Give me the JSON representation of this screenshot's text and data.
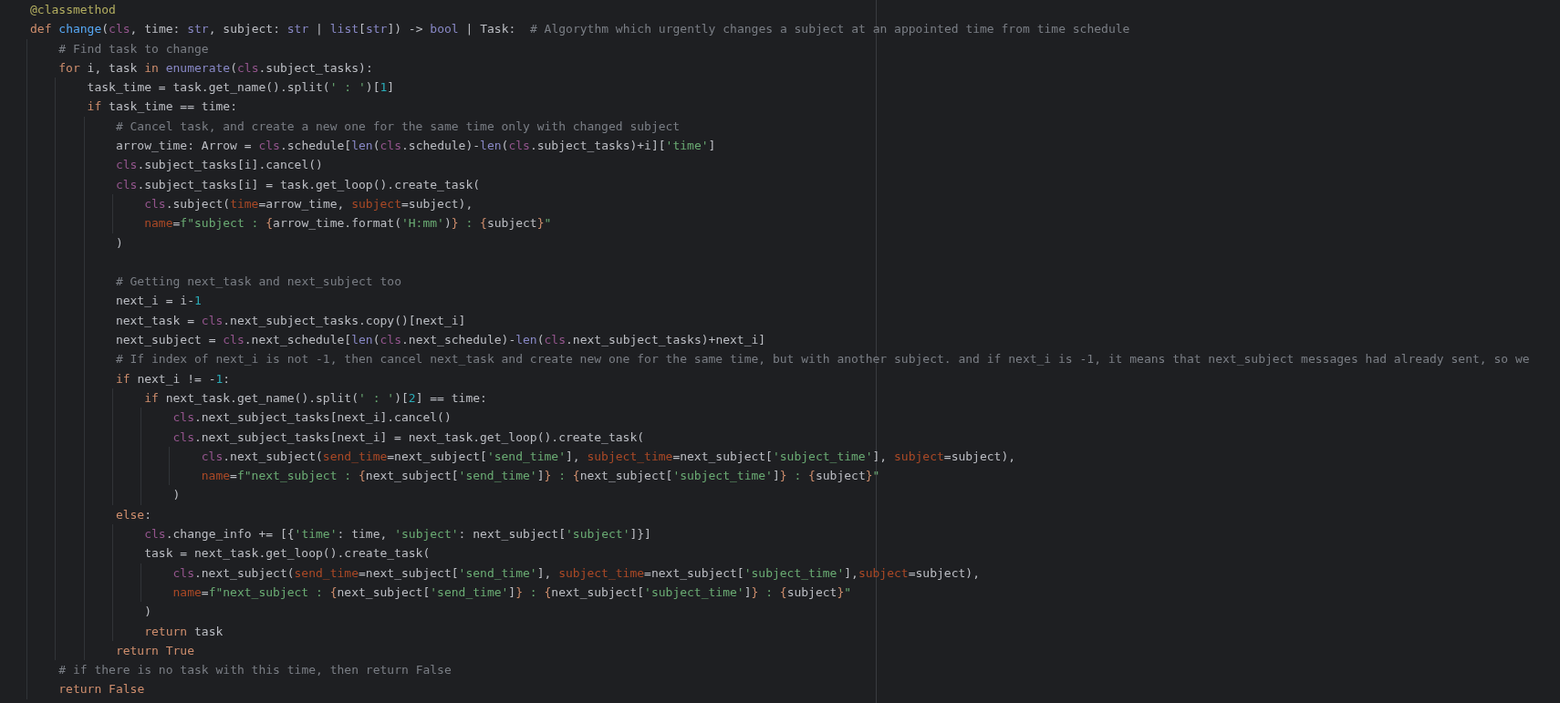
{
  "editor": {
    "lines": [
      {
        "kind": "code",
        "tokens": [
          {
            "kind": "decorator",
            "text": "@classmethod"
          }
        ]
      },
      {
        "kind": "code",
        "tokens": [
          {
            "kind": "keyword",
            "text": "def "
          },
          {
            "kind": "function",
            "text": "change"
          },
          {
            "kind": "plain",
            "text": "("
          },
          {
            "kind": "self",
            "text": "cls"
          },
          {
            "kind": "plain",
            "text": ", time: "
          },
          {
            "kind": "builtin",
            "text": "str"
          },
          {
            "kind": "plain",
            "text": ", subject: "
          },
          {
            "kind": "builtin",
            "text": "str"
          },
          {
            "kind": "plain",
            "text": " | "
          },
          {
            "kind": "builtin",
            "text": "list"
          },
          {
            "kind": "plain",
            "text": "["
          },
          {
            "kind": "builtin",
            "text": "str"
          },
          {
            "kind": "plain",
            "text": "]) -> "
          },
          {
            "kind": "builtin",
            "text": "bool"
          },
          {
            "kind": "plain",
            "text": " | Task:  "
          },
          {
            "kind": "comment",
            "text": "# Algorythm which urgently changes a subject at an appointed time from time schedule"
          }
        ],
        "children": [
          {
            "kind": "code",
            "tokens": [
              {
                "kind": "comment",
                "text": "# Find task to change"
              }
            ]
          },
          {
            "kind": "code",
            "tokens": [
              {
                "kind": "keyword",
                "text": "for "
              },
              {
                "kind": "plain",
                "text": "i, task "
              },
              {
                "kind": "keyword",
                "text": "in "
              },
              {
                "kind": "builtin",
                "text": "enumerate"
              },
              {
                "kind": "plain",
                "text": "("
              },
              {
                "kind": "self",
                "text": "cls"
              },
              {
                "kind": "plain",
                "text": ".subject_tasks):"
              }
            ],
            "children": [
              {
                "kind": "code",
                "tokens": [
                  {
                    "kind": "plain",
                    "text": "task_time = task.get_name().split("
                  },
                  {
                    "kind": "string",
                    "text": "' : '"
                  },
                  {
                    "kind": "plain",
                    "text": ")["
                  },
                  {
                    "kind": "number",
                    "text": "1"
                  },
                  {
                    "kind": "plain",
                    "text": "]"
                  }
                ]
              },
              {
                "kind": "code",
                "tokens": [
                  {
                    "kind": "keyword",
                    "text": "if "
                  },
                  {
                    "kind": "plain",
                    "text": "task_time == time:"
                  }
                ],
                "children": [
                  {
                    "kind": "code",
                    "tokens": [
                      {
                        "kind": "comment",
                        "text": "# Cancel task, and create a new one for the same time only with changed subject"
                      }
                    ]
                  },
                  {
                    "kind": "code",
                    "tokens": [
                      {
                        "kind": "plain",
                        "text": "arrow_time: Arrow = "
                      },
                      {
                        "kind": "self",
                        "text": "cls"
                      },
                      {
                        "kind": "plain",
                        "text": ".schedule["
                      },
                      {
                        "kind": "builtin",
                        "text": "len"
                      },
                      {
                        "kind": "plain",
                        "text": "("
                      },
                      {
                        "kind": "self",
                        "text": "cls"
                      },
                      {
                        "kind": "plain",
                        "text": ".schedule)-"
                      },
                      {
                        "kind": "builtin",
                        "text": "len"
                      },
                      {
                        "kind": "plain",
                        "text": "("
                      },
                      {
                        "kind": "self",
                        "text": "cls"
                      },
                      {
                        "kind": "plain",
                        "text": ".subject_tasks)+i]["
                      },
                      {
                        "kind": "string",
                        "text": "'time'"
                      },
                      {
                        "kind": "plain",
                        "text": "]"
                      }
                    ]
                  },
                  {
                    "kind": "code",
                    "tokens": [
                      {
                        "kind": "self",
                        "text": "cls"
                      },
                      {
                        "kind": "plain",
                        "text": ".subject_tasks[i].cancel()"
                      }
                    ]
                  },
                  {
                    "kind": "code",
                    "tokens": [
                      {
                        "kind": "self",
                        "text": "cls"
                      },
                      {
                        "kind": "plain",
                        "text": ".subject_tasks[i] = task.get_loop().create_task("
                      }
                    ],
                    "children": [
                      {
                        "kind": "code",
                        "tokens": [
                          {
                            "kind": "self",
                            "text": "cls"
                          },
                          {
                            "kind": "plain",
                            "text": ".subject("
                          },
                          {
                            "kind": "param",
                            "text": "time"
                          },
                          {
                            "kind": "plain",
                            "text": "=arrow_time, "
                          },
                          {
                            "kind": "param",
                            "text": "subject"
                          },
                          {
                            "kind": "plain",
                            "text": "=subject),"
                          }
                        ]
                      },
                      {
                        "kind": "code",
                        "tokens": [
                          {
                            "kind": "param",
                            "text": "name"
                          },
                          {
                            "kind": "plain",
                            "text": "="
                          },
                          {
                            "kind": "string",
                            "text": "f\"subject : "
                          },
                          {
                            "kind": "fbrace",
                            "text": "{"
                          },
                          {
                            "kind": "plain",
                            "text": "arrow_time.format("
                          },
                          {
                            "kind": "string",
                            "text": "'H:mm'"
                          },
                          {
                            "kind": "plain",
                            "text": ")"
                          },
                          {
                            "kind": "fbrace",
                            "text": "}"
                          },
                          {
                            "kind": "string",
                            "text": " : "
                          },
                          {
                            "kind": "fbrace",
                            "text": "{"
                          },
                          {
                            "kind": "plain",
                            "text": "subject"
                          },
                          {
                            "kind": "fbrace",
                            "text": "}"
                          },
                          {
                            "kind": "string",
                            "text": "\""
                          }
                        ]
                      }
                    ]
                  },
                  {
                    "kind": "code",
                    "tokens": [
                      {
                        "kind": "plain",
                        "text": ")"
                      }
                    ]
                  },
                  {
                    "kind": "blank"
                  },
                  {
                    "kind": "code",
                    "tokens": [
                      {
                        "kind": "comment",
                        "text": "# Getting next_task and next_subject too"
                      }
                    ]
                  },
                  {
                    "kind": "code",
                    "tokens": [
                      {
                        "kind": "plain",
                        "text": "next_i = i-"
                      },
                      {
                        "kind": "number",
                        "text": "1"
                      }
                    ]
                  },
                  {
                    "kind": "code",
                    "tokens": [
                      {
                        "kind": "plain",
                        "text": "next_task = "
                      },
                      {
                        "kind": "self",
                        "text": "cls"
                      },
                      {
                        "kind": "plain",
                        "text": ".next_subject_tasks.copy()[next_i]"
                      }
                    ]
                  },
                  {
                    "kind": "code",
                    "tokens": [
                      {
                        "kind": "plain",
                        "text": "next_subject = "
                      },
                      {
                        "kind": "self",
                        "text": "cls"
                      },
                      {
                        "kind": "plain",
                        "text": ".next_schedule["
                      },
                      {
                        "kind": "builtin",
                        "text": "len"
                      },
                      {
                        "kind": "plain",
                        "text": "("
                      },
                      {
                        "kind": "self",
                        "text": "cls"
                      },
                      {
                        "kind": "plain",
                        "text": ".next_schedule)-"
                      },
                      {
                        "kind": "builtin",
                        "text": "len"
                      },
                      {
                        "kind": "plain",
                        "text": "("
                      },
                      {
                        "kind": "self",
                        "text": "cls"
                      },
                      {
                        "kind": "plain",
                        "text": ".next_subject_tasks)+next_i]"
                      }
                    ]
                  },
                  {
                    "kind": "code",
                    "tokens": [
                      {
                        "kind": "comment",
                        "text": "# If index of next_i is not -1, then cancel next_task and create new one for the same time, but with another subject. and if next_i is -1, it means that next_subject messages had already sent, so we"
                      }
                    ]
                  },
                  {
                    "kind": "code",
                    "tokens": [
                      {
                        "kind": "keyword",
                        "text": "if "
                      },
                      {
                        "kind": "plain",
                        "text": "next_i != -"
                      },
                      {
                        "kind": "number",
                        "text": "1"
                      },
                      {
                        "kind": "plain",
                        "text": ":"
                      }
                    ],
                    "children": [
                      {
                        "kind": "code",
                        "tokens": [
                          {
                            "kind": "keyword",
                            "text": "if "
                          },
                          {
                            "kind": "plain",
                            "text": "next_task.get_name().split("
                          },
                          {
                            "kind": "string",
                            "text": "' : '"
                          },
                          {
                            "kind": "plain",
                            "text": ")["
                          },
                          {
                            "kind": "number",
                            "text": "2"
                          },
                          {
                            "kind": "plain",
                            "text": "] == time:"
                          }
                        ],
                        "children": [
                          {
                            "kind": "code",
                            "tokens": [
                              {
                                "kind": "self",
                                "text": "cls"
                              },
                              {
                                "kind": "plain",
                                "text": ".next_subject_tasks[next_i].cancel()"
                              }
                            ]
                          },
                          {
                            "kind": "code",
                            "tokens": [
                              {
                                "kind": "self",
                                "text": "cls"
                              },
                              {
                                "kind": "plain",
                                "text": ".next_subject_tasks[next_i] = next_task.get_loop().create_task("
                              }
                            ],
                            "children": [
                              {
                                "kind": "code",
                                "tokens": [
                                  {
                                    "kind": "self",
                                    "text": "cls"
                                  },
                                  {
                                    "kind": "plain",
                                    "text": ".next_subject("
                                  },
                                  {
                                    "kind": "param",
                                    "text": "send_time"
                                  },
                                  {
                                    "kind": "plain",
                                    "text": "=next_subject["
                                  },
                                  {
                                    "kind": "string",
                                    "text": "'send_time'"
                                  },
                                  {
                                    "kind": "plain",
                                    "text": "], "
                                  },
                                  {
                                    "kind": "param",
                                    "text": "subject_time"
                                  },
                                  {
                                    "kind": "plain",
                                    "text": "=next_subject["
                                  },
                                  {
                                    "kind": "string",
                                    "text": "'subject_time'"
                                  },
                                  {
                                    "kind": "plain",
                                    "text": "], "
                                  },
                                  {
                                    "kind": "param",
                                    "text": "subject"
                                  },
                                  {
                                    "kind": "plain",
                                    "text": "=subject),"
                                  }
                                ]
                              },
                              {
                                "kind": "code",
                                "tokens": [
                                  {
                                    "kind": "param",
                                    "text": "name"
                                  },
                                  {
                                    "kind": "plain",
                                    "text": "="
                                  },
                                  {
                                    "kind": "string",
                                    "text": "f\"next_subject : "
                                  },
                                  {
                                    "kind": "fbrace",
                                    "text": "{"
                                  },
                                  {
                                    "kind": "plain",
                                    "text": "next_subject["
                                  },
                                  {
                                    "kind": "string",
                                    "text": "'send_time'"
                                  },
                                  {
                                    "kind": "plain",
                                    "text": "]"
                                  },
                                  {
                                    "kind": "fbrace",
                                    "text": "}"
                                  },
                                  {
                                    "kind": "string",
                                    "text": " : "
                                  },
                                  {
                                    "kind": "fbrace",
                                    "text": "{"
                                  },
                                  {
                                    "kind": "plain",
                                    "text": "next_subject["
                                  },
                                  {
                                    "kind": "string",
                                    "text": "'subject_time'"
                                  },
                                  {
                                    "kind": "plain",
                                    "text": "]"
                                  },
                                  {
                                    "kind": "fbrace",
                                    "text": "}"
                                  },
                                  {
                                    "kind": "string",
                                    "text": " : "
                                  },
                                  {
                                    "kind": "fbrace",
                                    "text": "{"
                                  },
                                  {
                                    "kind": "plain",
                                    "text": "subject"
                                  },
                                  {
                                    "kind": "fbrace",
                                    "text": "}"
                                  },
                                  {
                                    "kind": "string",
                                    "text": "\""
                                  }
                                ]
                              }
                            ]
                          },
                          {
                            "kind": "code",
                            "tokens": [
                              {
                                "kind": "plain",
                                "text": ")"
                              }
                            ]
                          }
                        ]
                      }
                    ]
                  },
                  {
                    "kind": "code",
                    "tokens": [
                      {
                        "kind": "keyword",
                        "text": "else"
                      },
                      {
                        "kind": "plain",
                        "text": ":"
                      }
                    ],
                    "children": [
                      {
                        "kind": "code",
                        "tokens": [
                          {
                            "kind": "self",
                            "text": "cls"
                          },
                          {
                            "kind": "plain",
                            "text": ".change_info += [{"
                          },
                          {
                            "kind": "string",
                            "text": "'time'"
                          },
                          {
                            "kind": "plain",
                            "text": ": time, "
                          },
                          {
                            "kind": "string",
                            "text": "'subject'"
                          },
                          {
                            "kind": "plain",
                            "text": ": next_subject["
                          },
                          {
                            "kind": "string",
                            "text": "'subject'"
                          },
                          {
                            "kind": "plain",
                            "text": "]}]"
                          }
                        ]
                      },
                      {
                        "kind": "code",
                        "tokens": [
                          {
                            "kind": "plain",
                            "text": "task = next_task.get_loop().create_task("
                          }
                        ],
                        "children": [
                          {
                            "kind": "code",
                            "tokens": [
                              {
                                "kind": "self",
                                "text": "cls"
                              },
                              {
                                "kind": "plain",
                                "text": ".next_subject("
                              },
                              {
                                "kind": "param",
                                "text": "send_time"
                              },
                              {
                                "kind": "plain",
                                "text": "=next_subject["
                              },
                              {
                                "kind": "string",
                                "text": "'send_time'"
                              },
                              {
                                "kind": "plain",
                                "text": "], "
                              },
                              {
                                "kind": "param",
                                "text": "subject_time"
                              },
                              {
                                "kind": "plain",
                                "text": "=next_subject["
                              },
                              {
                                "kind": "string",
                                "text": "'subject_time'"
                              },
                              {
                                "kind": "plain",
                                "text": "],"
                              },
                              {
                                "kind": "param",
                                "text": "subject"
                              },
                              {
                                "kind": "plain",
                                "text": "=subject),"
                              }
                            ]
                          },
                          {
                            "kind": "code",
                            "tokens": [
                              {
                                "kind": "param",
                                "text": "name"
                              },
                              {
                                "kind": "plain",
                                "text": "="
                              },
                              {
                                "kind": "string",
                                "text": "f\"next_subject : "
                              },
                              {
                                "kind": "fbrace",
                                "text": "{"
                              },
                              {
                                "kind": "plain",
                                "text": "next_subject["
                              },
                              {
                                "kind": "string",
                                "text": "'send_time'"
                              },
                              {
                                "kind": "plain",
                                "text": "]"
                              },
                              {
                                "kind": "fbrace",
                                "text": "}"
                              },
                              {
                                "kind": "string",
                                "text": " : "
                              },
                              {
                                "kind": "fbrace",
                                "text": "{"
                              },
                              {
                                "kind": "plain",
                                "text": "next_subject["
                              },
                              {
                                "kind": "string",
                                "text": "'subject_time'"
                              },
                              {
                                "kind": "plain",
                                "text": "]"
                              },
                              {
                                "kind": "fbrace",
                                "text": "}"
                              },
                              {
                                "kind": "string",
                                "text": " : "
                              },
                              {
                                "kind": "fbrace",
                                "text": "{"
                              },
                              {
                                "kind": "plain",
                                "text": "subject"
                              },
                              {
                                "kind": "fbrace",
                                "text": "}"
                              },
                              {
                                "kind": "string",
                                "text": "\""
                              }
                            ]
                          }
                        ]
                      },
                      {
                        "kind": "code",
                        "tokens": [
                          {
                            "kind": "plain",
                            "text": ")"
                          }
                        ]
                      },
                      {
                        "kind": "code",
                        "tokens": [
                          {
                            "kind": "keyword",
                            "text": "return "
                          },
                          {
                            "kind": "plain",
                            "text": "task"
                          }
                        ]
                      }
                    ]
                  },
                  {
                    "kind": "code",
                    "tokens": [
                      {
                        "kind": "keyword",
                        "text": "return True"
                      }
                    ]
                  }
                ]
              }
            ]
          },
          {
            "kind": "code",
            "tokens": [
              {
                "kind": "comment",
                "text": "# if there is no task with this time, then return False"
              }
            ]
          },
          {
            "kind": "code",
            "tokens": [
              {
                "kind": "keyword",
                "text": "return False"
              }
            ]
          }
        ]
      }
    ]
  }
}
